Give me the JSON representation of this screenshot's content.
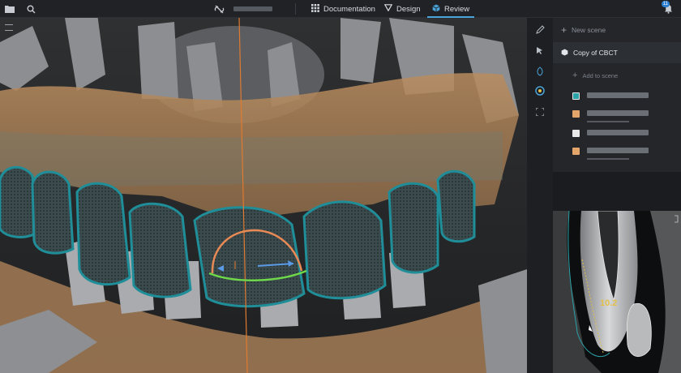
{
  "topbar": {
    "nav": [
      {
        "label": "Documentation",
        "icon": "grid-icon"
      },
      {
        "label": "Design",
        "icon": "triangle-icon"
      },
      {
        "label": "Review",
        "icon": "cube-icon"
      }
    ],
    "active_tab": "Review",
    "notification_count": "11"
  },
  "sidebar": {
    "new_scene_label": "New scene",
    "scene_title": "Copy of CBCT",
    "add_to_scene_label": "Add to scene",
    "items": [
      {
        "swatch_color": "#2aa3a8",
        "icon": "mesh-swatch"
      },
      {
        "swatch_color": "#e3a56a",
        "icon": "mesh-swatch"
      },
      {
        "swatch_color": "#e8e8e8",
        "icon": "ct-scan-icon"
      },
      {
        "swatch_color": "#e3a56a",
        "icon": "mesh-swatch"
      }
    ]
  },
  "xray": {
    "measurement": "10.2"
  },
  "colors": {
    "accent": "#4aa3d8",
    "gingiva": "#c99a6a",
    "mesh": "#1f8e99"
  }
}
